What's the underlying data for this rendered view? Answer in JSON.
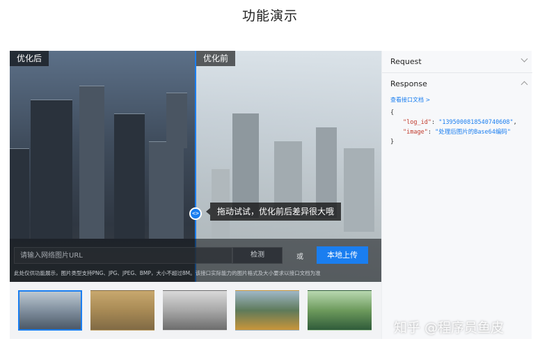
{
  "page": {
    "title": "功能演示"
  },
  "demo": {
    "label_after": "优化后",
    "label_before": "优化前",
    "handle_symbol": "<>",
    "tooltip": "拖动试试，优化前后差异很大哦",
    "url_placeholder": "请输入网络图片URL",
    "detect_label": "检测",
    "or_label": "或",
    "upload_label": "本地上传",
    "notice": "此处仅供功能展示，图片类型支持PNG、JPG、JPEG、BMP，大小不超过8M。该接口实际能力的图片格式及大小要求以接口文档为准"
  },
  "panel": {
    "request_title": "Request",
    "response_title": "Response",
    "doc_link": "查看接口文档 >",
    "code": {
      "open": "{",
      "log_id_key": "\"log_id\"",
      "log_id_value": "\"1395000818540740608\"",
      "image_key": "\"image\"",
      "image_value": "\"处理后图片的Base64编码\"",
      "close": "}"
    }
  },
  "thumbnails": [
    {
      "name": "city-haze",
      "selected": true
    },
    {
      "name": "sandy-city",
      "selected": false
    },
    {
      "name": "foggy-trees",
      "selected": false
    },
    {
      "name": "autumn-forest",
      "selected": false
    },
    {
      "name": "garden-mist",
      "selected": false
    }
  ],
  "watermark": "知乎 @程序员鱼皮"
}
